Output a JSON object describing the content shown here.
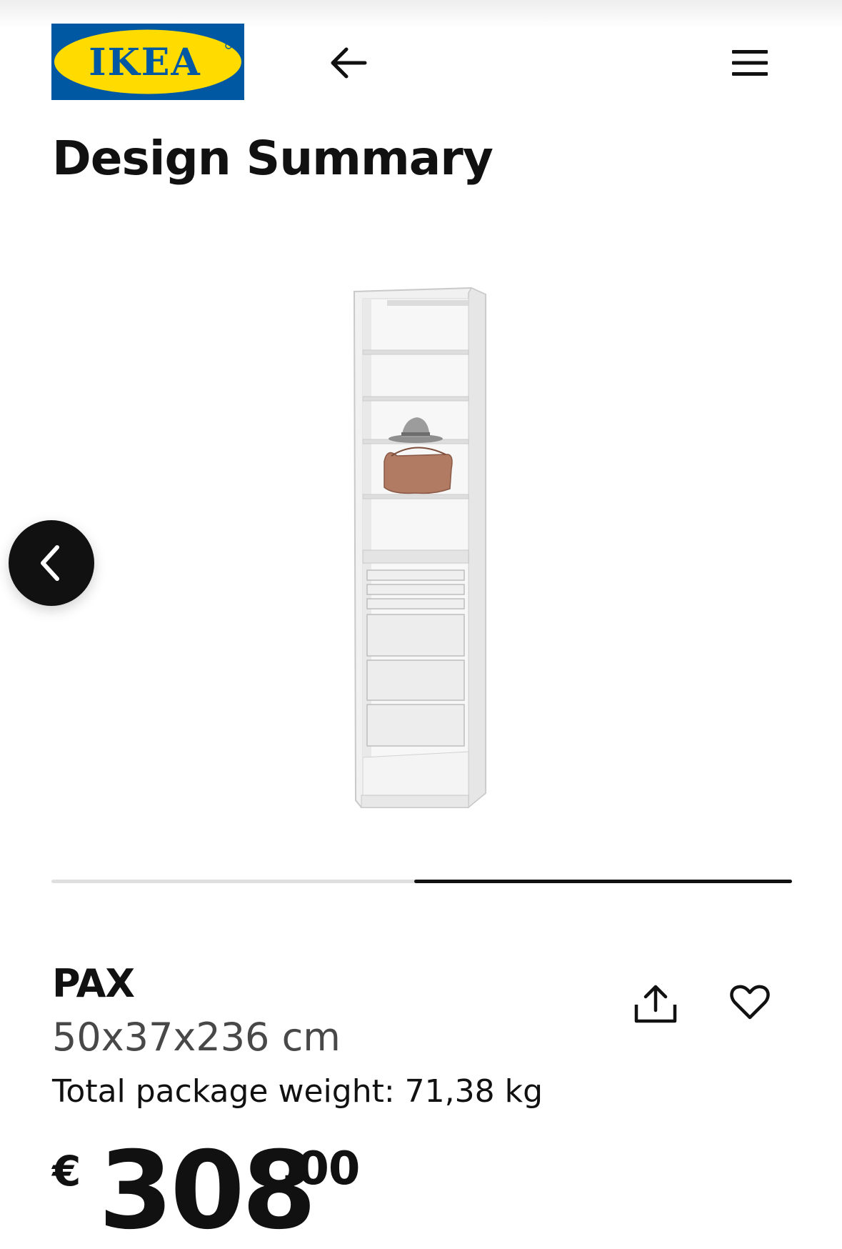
{
  "header": {
    "logo_text": "IKEA",
    "back_icon": "arrow-left-icon",
    "menu_icon": "hamburger-menu-icon",
    "brand_colors": {
      "blue": "#0058A3",
      "yellow": "#FFDB00"
    }
  },
  "page": {
    "title": "Design Summary"
  },
  "carousel": {
    "prev_icon": "chevron-left-icon",
    "progress_fraction": 0.51,
    "image_alt": "PAX wardrobe with shelves, hat, bag and drawers"
  },
  "product": {
    "name": "PAX",
    "dimensions": "50x37x236 cm",
    "weight": "Total package weight: 71,38 kg",
    "share_icon": "share-icon",
    "favourite_icon": "heart-icon"
  },
  "price": {
    "currency": "€",
    "integer": "308",
    "decimal": ",00"
  }
}
